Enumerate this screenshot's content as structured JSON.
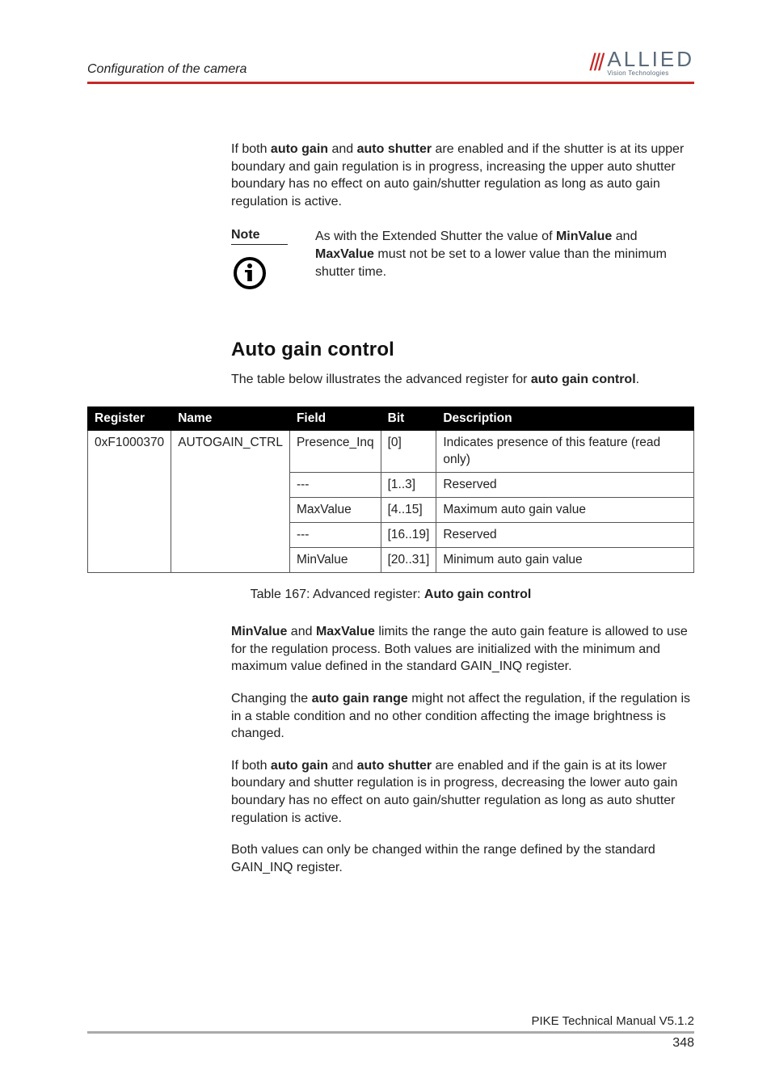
{
  "header": {
    "title": "Configuration of the camera",
    "logo_main": "ALLIED",
    "logo_sub": "Vision Technologies"
  },
  "intro_para_before": "If both ",
  "b_autogain": "auto gain",
  "intro_mid1": " and ",
  "b_autoshutter": "auto shutter",
  "intro_after1": " are enabled and if the shutter is at its upper boundary and gain regulation is in progress, increasing the upper auto shutter boundary has no effect on auto gain/shutter regulation as long as auto gain regulation is active.",
  "note": {
    "label": "Note",
    "text_pre": "As with the Extended Shutter the value of ",
    "b_min": "MinValue",
    "text_mid1": " and ",
    "b_max": "MaxValue",
    "text_post": " must not be set to a lower value than the minimum shutter time."
  },
  "section": {
    "heading": "Auto gain control",
    "intro_pre": "The table below illustrates the advanced register for ",
    "intro_bold": "auto gain control",
    "intro_post": "."
  },
  "table": {
    "headers": {
      "c1": "Register",
      "c2": "Name",
      "c3": "Field",
      "c4": "Bit",
      "c5": "Description"
    },
    "rows": [
      {
        "reg": "0xF1000370",
        "name": "AUTOGAIN_CTRL",
        "field": "Presence_Inq",
        "bit": "[0]",
        "desc": "Indicates presence of this feature (read only)"
      },
      {
        "reg": "",
        "name": "",
        "field": "---",
        "bit": "[1..3]",
        "desc": "Reserved"
      },
      {
        "reg": "",
        "name": "",
        "field": "MaxValue",
        "bit": "[4..15]",
        "desc": "Maximum auto gain value"
      },
      {
        "reg": "",
        "name": "",
        "field": "---",
        "bit": "[16..19]",
        "desc": "Reserved"
      },
      {
        "reg": "",
        "name": "",
        "field": "MinValue",
        "bit": "[20..31]",
        "desc": "Minimum auto gain value"
      }
    ],
    "caption_pre": "Table 167: Advanced register: ",
    "caption_bold": "Auto gain control"
  },
  "body": {
    "p1_b1": "MinValue",
    "p1_mid": " and ",
    "p1_b2": "MaxValue",
    "p1_rest": " limits the range the auto gain feature is allowed to use for the regulation process. Both values are initialized with the minimum and maximum value defined in the standard GAIN_INQ register.",
    "p2_pre": "Changing the ",
    "p2_bold": "auto gain range",
    "p2_rest": " might not affect the regulation, if the regulation is in a stable condition and no other condition affecting the image brightness is changed.",
    "p3_pre": "If both ",
    "p3_b1": "auto gain",
    "p3_mid": " and ",
    "p3_b2": "auto shutter",
    "p3_rest": " are enabled and if the gain is at its lower boundary and shutter regulation is in progress, decreasing the lower auto gain boundary has no effect on auto gain/shutter regulation as long as auto shutter regulation is active.",
    "p4": "Both values can only be changed within the range defined by the standard GAIN_INQ register."
  },
  "footer": {
    "doc": "PIKE Technical Manual V5.1.2",
    "page": "348"
  }
}
